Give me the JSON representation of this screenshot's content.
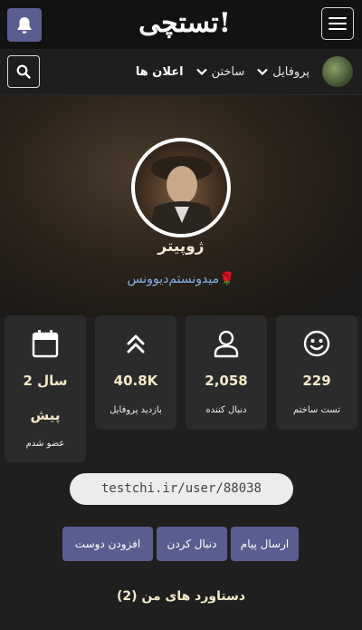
{
  "header": {
    "logo_text": "تستچی!",
    "accent_color": "#5a5d8f"
  },
  "nav": {
    "items": [
      {
        "label": "پروفایل",
        "has_dropdown": true
      },
      {
        "label": "ساختن",
        "has_dropdown": true
      },
      {
        "label": "اعلان ها",
        "has_dropdown": false
      }
    ]
  },
  "profile": {
    "username": "ژوپیتر",
    "bio": "میدونستم‌دیوونس🌹"
  },
  "stats": [
    {
      "icon": "smile-icon",
      "value": "229",
      "label": "تست ساختم"
    },
    {
      "icon": "user-icon",
      "value": "2,058",
      "label": "دنبال کننده"
    },
    {
      "icon": "double-chevron-up-icon",
      "value": "40.8K",
      "label": "بازدید پروفایل"
    },
    {
      "icon": "calendar-icon",
      "value_line1": "2 سال",
      "value_line2": "پیش",
      "label": "عضو شدم"
    }
  ],
  "profile_url": "testchi.ir/user/88038",
  "actions": {
    "send_message": "ارسال پیام",
    "follow": "دنبال کردن",
    "add_friend": "افزودن دوست"
  },
  "achievements_title": "دستاورد های من (2)"
}
